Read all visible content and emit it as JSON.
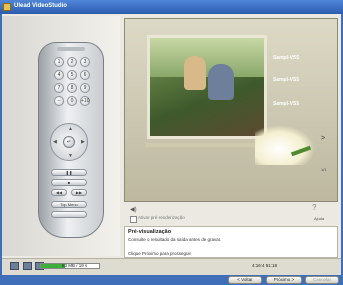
{
  "window": {
    "title": "Ulead VideoStudio"
  },
  "menu_items": [
    "Sampl-VS5",
    "Sampl-VS5",
    "Sampl-VS5"
  ],
  "nav": {
    "arrow": ">",
    "page": "1/1"
  },
  "checkbox_label": "Ativar pré-renderização",
  "help_label": "Ajuda",
  "info": {
    "title": "Pré-visualização",
    "description": "Consulte o resultado da saída antes de gravar.",
    "hint": "Clique Próximo para prosseguir"
  },
  "status": {
    "disk": "63 MB / 19 s",
    "timecode": "4:16:4 51:18",
    "progress": 0.42
  },
  "buttons": {
    "back": "< Voltar",
    "next": "Próximo >",
    "cancel": "Cancelar"
  },
  "remote": {
    "top_button": "Top Menu"
  }
}
